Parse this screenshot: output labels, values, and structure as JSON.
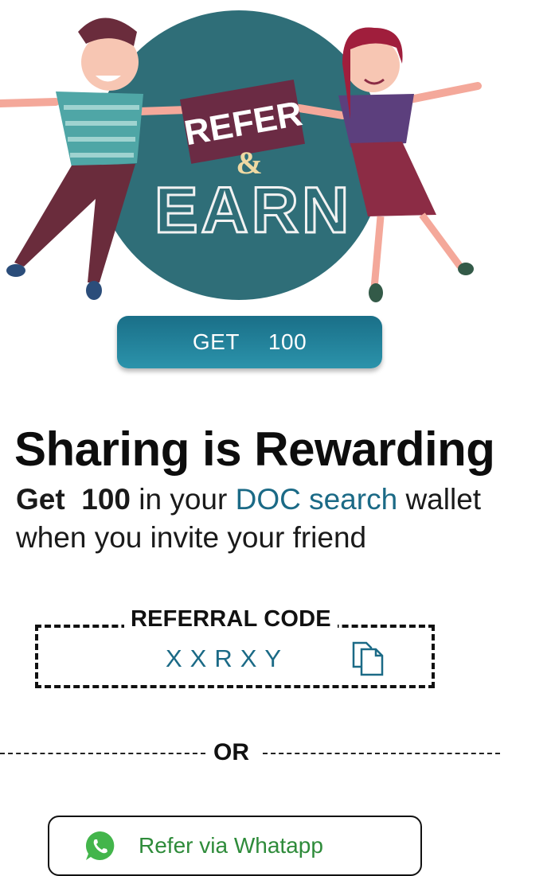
{
  "hero": {
    "refer_text": "REFER",
    "amp_text": "&",
    "earn_text": "EARN"
  },
  "get_button": {
    "prefix": "GET",
    "amount": "100"
  },
  "headline": "Sharing is Rewarding",
  "subtitle": {
    "get_word": "Get",
    "amount": "100",
    "in_your": "in your",
    "brand": "DOC search",
    "wallet": "wallet",
    "line2": "when you invite your friend"
  },
  "referral": {
    "label": "REFERRAL CODE",
    "code": "XXRXY"
  },
  "divider": {
    "label": "OR"
  },
  "whatsapp": {
    "label": "Refer via Whatapp"
  },
  "colors": {
    "accent": "#1b6a86",
    "circle": "#2f6e78",
    "whatsapp_green": "#2e8b3a"
  },
  "icons": [
    "copy-icon",
    "whatsapp-icon"
  ]
}
